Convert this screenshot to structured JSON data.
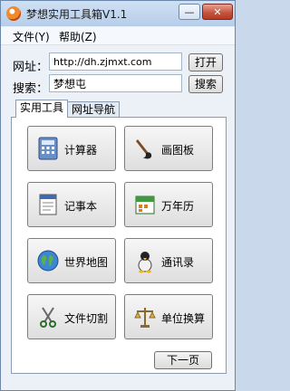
{
  "window": {
    "title": "梦想实用工具箱V1.1",
    "minimize_symbol": "—",
    "close_symbol": "✕"
  },
  "menu": {
    "file": "文件(Y)",
    "help": "帮助(Z)"
  },
  "url_row": {
    "label": "网址：",
    "value": "http://dh.zjmxt.com",
    "button": "打开"
  },
  "search_row": {
    "label": "搜索：",
    "value": "梦想屯",
    "button": "搜索"
  },
  "tabs": [
    {
      "label": "实用工具"
    },
    {
      "label": "网址导航"
    }
  ],
  "tools": [
    {
      "label": "计算器",
      "icon": "calculator-icon"
    },
    {
      "label": "画图板",
      "icon": "paintbrush-icon"
    },
    {
      "label": "记事本",
      "icon": "notepad-icon"
    },
    {
      "label": "万年历",
      "icon": "calendar-icon"
    },
    {
      "label": "世界地图",
      "icon": "globe-icon"
    },
    {
      "label": "通讯录",
      "icon": "contacts-icon"
    },
    {
      "label": "文件切割",
      "icon": "scissors-icon"
    },
    {
      "label": "单位换算",
      "icon": "scale-icon"
    }
  ],
  "next_page": "下一页"
}
